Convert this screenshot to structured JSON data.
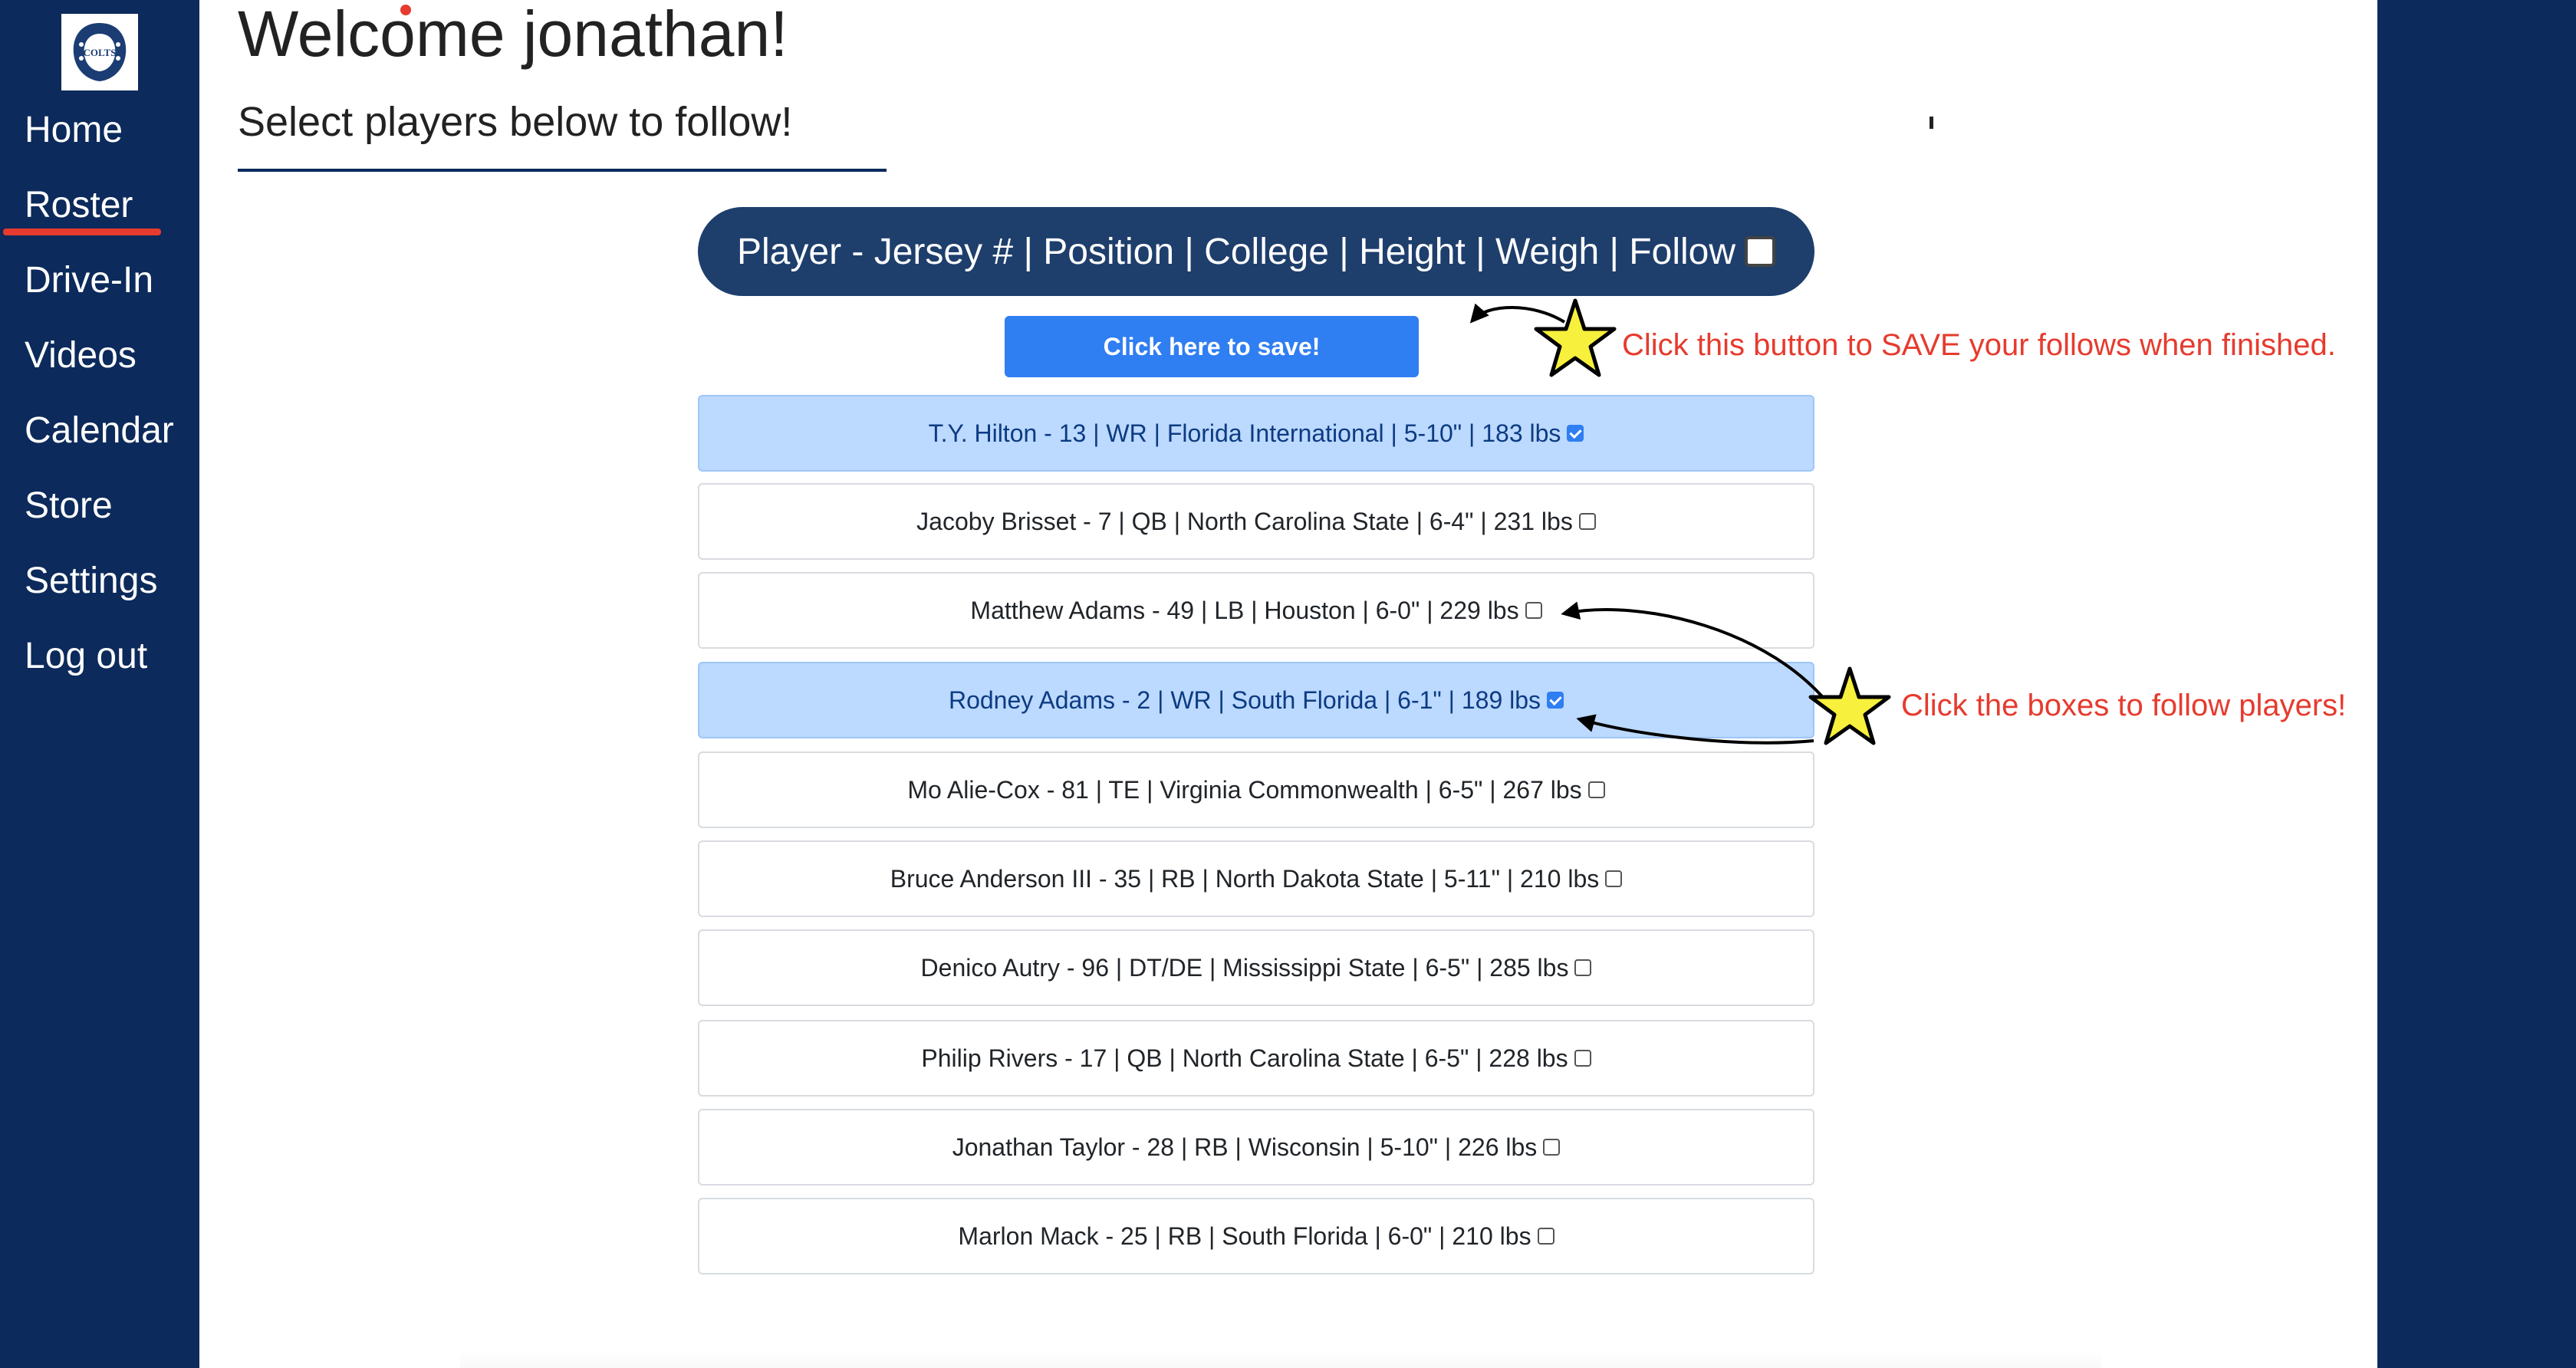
{
  "sidebar": {
    "logo_icon": "colts-horseshoe-logo",
    "logo_text": "COLTS",
    "items": [
      {
        "label": "Home",
        "active": false
      },
      {
        "label": "Roster",
        "active": true
      },
      {
        "label": "Drive-In",
        "active": false
      },
      {
        "label": "Videos",
        "active": false
      },
      {
        "label": "Calendar",
        "active": false
      },
      {
        "label": "Store",
        "active": false
      },
      {
        "label": "Settings",
        "active": false
      },
      {
        "label": "Log out",
        "active": false
      }
    ]
  },
  "main": {
    "welcome": "Welcome jonathan!",
    "subtitle": "Select players below to follow!",
    "header": "Player - Jersey # | Position | College | Height | Weigh | Follow",
    "save_label": "Click here to save!",
    "players": [
      {
        "text": "T.Y. Hilton - 13 | WR | Florida International | 5-10\" | 183 lbs",
        "followed": true
      },
      {
        "text": "Jacoby Brisset - 7 | QB | North Carolina State | 6-4\" | 231 lbs",
        "followed": false
      },
      {
        "text": "Matthew Adams - 49 | LB | Houston | 6-0\" | 229 lbs",
        "followed": false
      },
      {
        "text": "Rodney Adams - 2 | WR | South Florida | 6-1\" | 189 lbs",
        "followed": true
      },
      {
        "text": "Mo Alie-Cox - 81 | TE | Virginia Commonwealth | 6-5\" | 267 lbs",
        "followed": false
      },
      {
        "text": "Bruce Anderson III - 35 | RB | North Dakota State | 5-11\" | 210 lbs",
        "followed": false
      },
      {
        "text": "Denico Autry - 96 | DT/DE | Mississippi State | 6-5\" | 285 lbs",
        "followed": false
      },
      {
        "text": "Philip Rivers - 17 | QB | North Carolina State | 6-5\" | 228 lbs",
        "followed": false
      },
      {
        "text": "Jonathan Taylor - 28 | RB | Wisconsin | 5-10\" | 226 lbs",
        "followed": false
      },
      {
        "text": "Marlon Mack - 25 | RB | South Florida | 6-0\" | 210 lbs",
        "followed": false
      }
    ]
  },
  "annotations": {
    "save_note": "Click this button to SAVE your follows when finished.",
    "follow_note": "Click the boxes to follow players!",
    "color": "#e63b2e",
    "star_color": "#f7f03c"
  },
  "colors": {
    "sidebar_bg": "#0c2a5b",
    "header_bg": "#1e3e6c",
    "button_bg": "#2f7ef2",
    "followed_row_bg": "#bcd9ff"
  }
}
